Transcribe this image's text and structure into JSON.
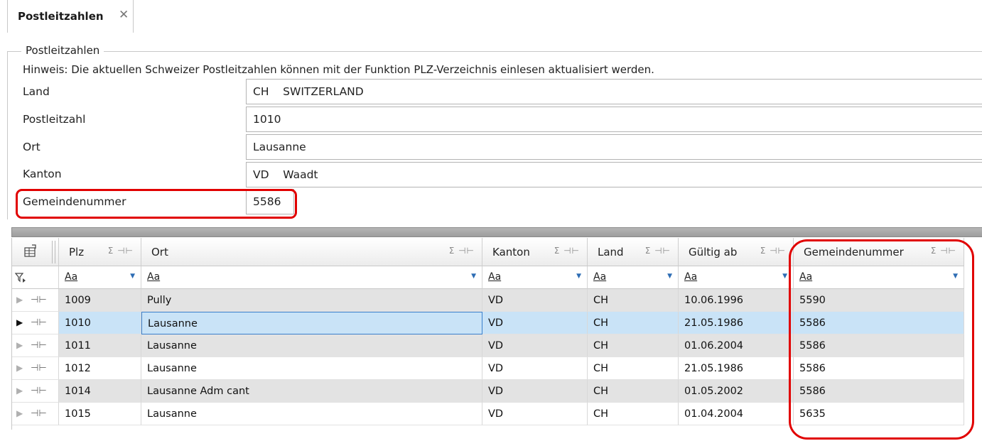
{
  "tab": {
    "title": "Postleitzahlen",
    "close": "✕"
  },
  "group": {
    "legend": "Postleitzahlen",
    "hint": "Hinweis: Die aktuellen Schweizer Postleitzahlen können mit der Funktion PLZ-Verzeichnis einlesen aktualisiert werden."
  },
  "form": {
    "land": {
      "label": "Land",
      "value": "CH    SWITZERLAND"
    },
    "plz": {
      "label": "Postleitzahl",
      "value": "1010"
    },
    "ort": {
      "label": "Ort",
      "value": "Lausanne"
    },
    "kanton": {
      "label": "Kanton",
      "value": "VD    Waadt"
    },
    "gemeinde": {
      "label": "Gemeindenummer",
      "value": "5586"
    }
  },
  "grid": {
    "chooser_icon": "column-chooser",
    "filter_icon": "filter",
    "sum_pin": "Σ ⊣⊢",
    "filter_value": "Aa",
    "columns": [
      "Plz",
      "Ort",
      "Kanton",
      "Land",
      "Gültig ab",
      "Gemeindenummer"
    ],
    "rows": [
      [
        "1009",
        "Pully",
        "VD",
        "CH",
        "10.06.1996",
        "5590"
      ],
      [
        "1010",
        "Lausanne",
        "VD",
        "CH",
        "21.05.1986",
        "5586"
      ],
      [
        "1011",
        "Lausanne",
        "VD",
        "CH",
        "01.06.2004",
        "5586"
      ],
      [
        "1012",
        "Lausanne",
        "VD",
        "CH",
        "21.05.1986",
        "5586"
      ],
      [
        "1014",
        "Lausanne Adm cant",
        "VD",
        "CH",
        "01.05.2002",
        "5586"
      ],
      [
        "1015",
        "Lausanne",
        "VD",
        "CH",
        "01.04.2004",
        "5635"
      ]
    ],
    "selected_row": 1
  },
  "colors": {
    "highlight": "#e10000",
    "selection": "#c9e3f7",
    "focus_border": "#3a7fcc"
  }
}
